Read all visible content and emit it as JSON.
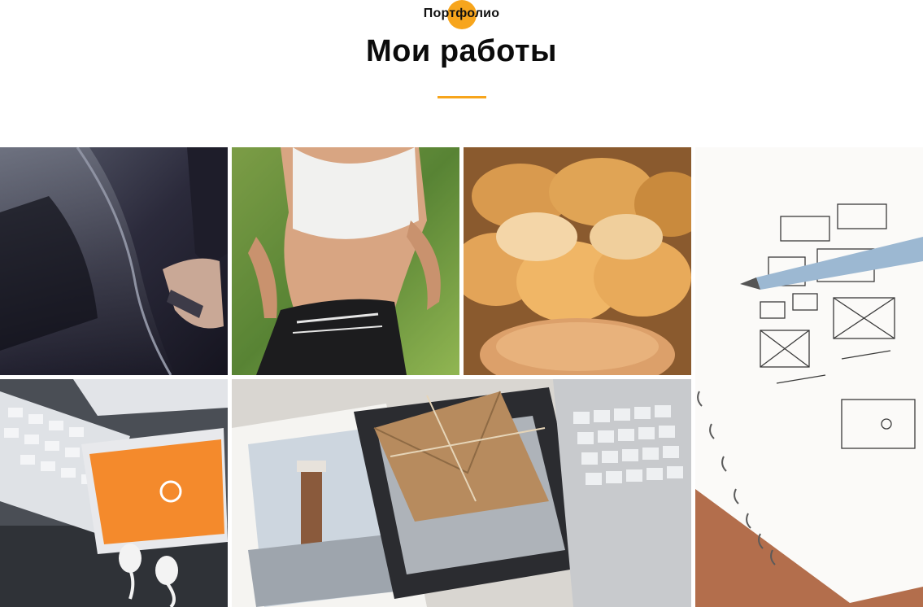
{
  "section": {
    "eyebrow": "Портфолио",
    "title": "Мои работы",
    "accent_color": "#f7a51c"
  },
  "portfolio": {
    "items": [
      {
        "id": "car-door",
        "depicts": "car door photo"
      },
      {
        "id": "runner",
        "depicts": "running woman photo"
      },
      {
        "id": "bread",
        "depicts": "braided bread photo"
      },
      {
        "id": "sketchbook",
        "depicts": "wireframe sketchbook with pen photo"
      },
      {
        "id": "phone-keyboard",
        "depicts": "phone, keyboard and headphones photo"
      },
      {
        "id": "laptop-envelope",
        "depicts": "laptop, envelope and photos"
      }
    ]
  }
}
